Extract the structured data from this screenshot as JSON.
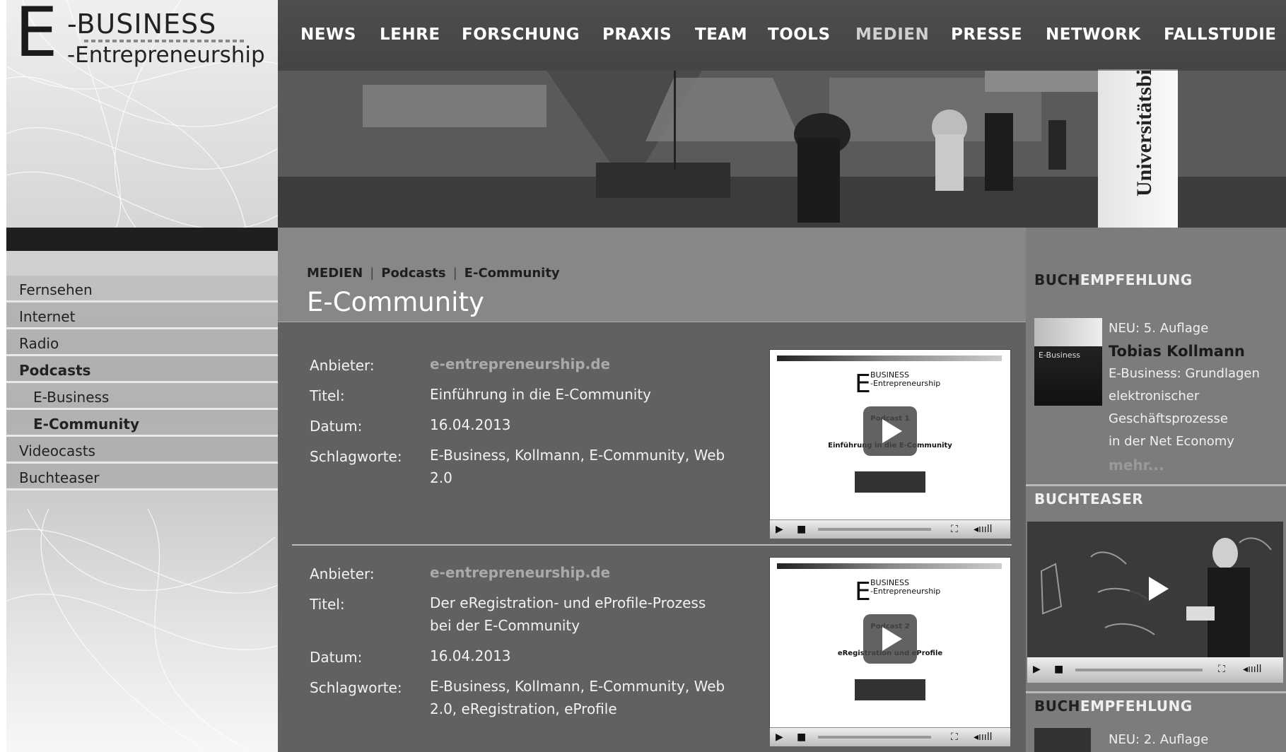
{
  "logo": {
    "letter": "E",
    "line1": "-BUSINESS",
    "line2": "-Entrepreneurship"
  },
  "topnav": [
    "NEWS",
    "LEHRE",
    "FORSCHUNG",
    "PRAXIS",
    "TEAM",
    "TOOLS",
    "MEDIEN",
    "PRESSE",
    "NETWORK",
    "FALLSTUDIE"
  ],
  "topnav_active": "MEDIEN",
  "hero": {
    "sign_text": "Universitätsbibl"
  },
  "sidenav": [
    {
      "label": "Fernsehen"
    },
    {
      "label": "Internet"
    },
    {
      "label": "Radio"
    },
    {
      "label": "Podcasts"
    },
    {
      "label": "E-Business"
    },
    {
      "label": "E-Community"
    },
    {
      "label": "Videocasts"
    },
    {
      "label": "Buchteaser"
    }
  ],
  "breadcrumb": [
    "MEDIEN",
    "Podcasts",
    "E-Community"
  ],
  "page_title": "E-Community",
  "field_labels": {
    "provider": "Anbieter:",
    "title": "Titel:",
    "date": "Datum:",
    "tags": "Schlagworte:"
  },
  "entries": [
    {
      "provider": "e-entrepreneurship.de",
      "title_line1": "Einführung in die E-Community",
      "title_line2": "",
      "date": "16.04.2013",
      "tags_line1": "E-Business, Kollmann, E-Community, Web",
      "tags_line2": "2.0",
      "player": {
        "logo_letter": "E",
        "logo_line1": "BUSINESS",
        "logo_line2": "-Entrepreneurship",
        "podcast_no": "Podcast 1",
        "podcast_title": "Einführung in die E-Community"
      }
    },
    {
      "provider": "e-entrepreneurship.de",
      "title_line1": "Der eRegistration- und eProfile-Prozess",
      "title_line2": "bei der E-Community",
      "date": "16.04.2013",
      "tags_line1": "E-Business, Kollmann, E-Community, Web",
      "tags_line2": "2.0, eRegistration, eProfile",
      "player": {
        "logo_letter": "E",
        "logo_line1": "BUSINESS",
        "logo_line2": "-Entrepreneurship",
        "podcast_no": "Podcast 2",
        "podcast_title": "eRegistration und eProfile"
      }
    }
  ],
  "sidebar": {
    "rec1": {
      "heading_a": "BUCH",
      "heading_b": "EMPFEHLUNG",
      "cover_label": "E-Business",
      "edition": "NEU: 5. Auflage",
      "author": "Tobias Kollmann",
      "lines": [
        "E-Business: Grundlagen",
        "elektronischer",
        "Geschäftsprozesse",
        "in der Net Economy"
      ],
      "more": "mehr..."
    },
    "teaser": {
      "heading": "BUCHTEASER"
    },
    "rec2": {
      "heading_a": "BUCH",
      "heading_b": "EMPFEHLUNG",
      "edition": "NEU: 2. Auflage"
    }
  },
  "colors": {
    "nav_bg": "#373737",
    "main_bg": "#878787",
    "entries_bg": "#616161",
    "sidebar_bg": "#7c7c7c",
    "link": "#aaaaaa"
  }
}
